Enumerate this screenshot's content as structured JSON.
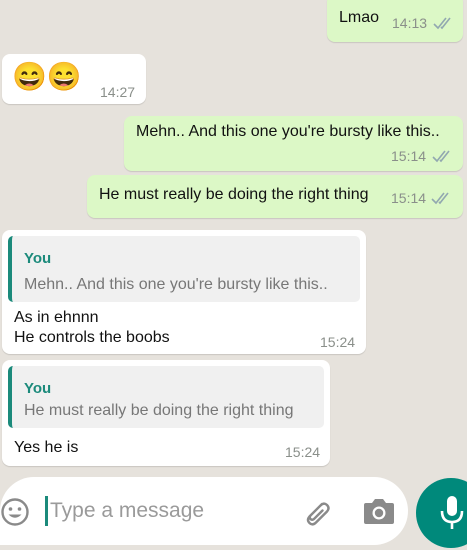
{
  "messages": [
    {
      "text": "Lmao",
      "time": "14:13",
      "ticks": "double-check-icon"
    },
    {
      "emoji": "😄😄",
      "time": "14:27"
    },
    {
      "text": "Mehn.. And this one you're bursty like this..",
      "time": "15:14",
      "ticks": "double-check-icon"
    },
    {
      "text": "He must really be doing the right thing",
      "time": "15:14",
      "ticks": "double-check-icon"
    },
    {
      "quote_author": "You",
      "quote_text": "Mehn.. And this one you're bursty like this..",
      "line1": "As in ehnnn",
      "line2": "He controls the boobs",
      "time": "15:24"
    },
    {
      "quote_author": "You",
      "quote_text": "He must really be doing the right thing",
      "text": "Yes he is",
      "time": "15:24"
    }
  ],
  "composer": {
    "placeholder": "Type a message"
  },
  "colors": {
    "outgoing": "#dcf8c6",
    "incoming": "#ffffff",
    "accent": "#00897b",
    "quote_bar": "#1b8a7b"
  }
}
